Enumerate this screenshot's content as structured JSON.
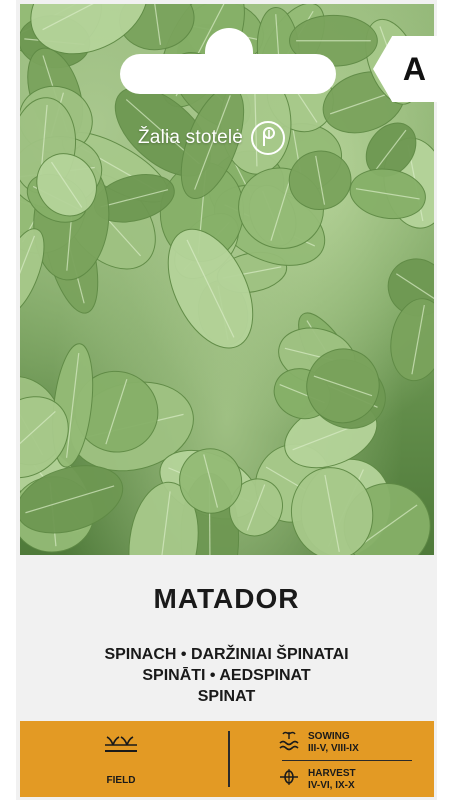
{
  "brand": {
    "name": "Žalia stotelė"
  },
  "badge": {
    "grade": "A"
  },
  "product": {
    "variety": "MATADOR",
    "line1": "SPINACH • DARŽINIAI ŠPINATAI",
    "line2": "SPINĀTI • AEDSPINAT",
    "line3": "SPINAT"
  },
  "info": {
    "field_label": "FIELD",
    "sowing_label": "SOWING",
    "sowing_months": "III-V, VIII-IX",
    "harvest_label": "HARVEST",
    "harvest_months": "IV-VI, IX-X"
  },
  "colors": {
    "accent_bar": "#e39a24",
    "leaf": "#7aa35c"
  },
  "icons": [
    "leaf-logo-icon",
    "field-rows-icon",
    "sowing-icon",
    "harvest-icon"
  ]
}
